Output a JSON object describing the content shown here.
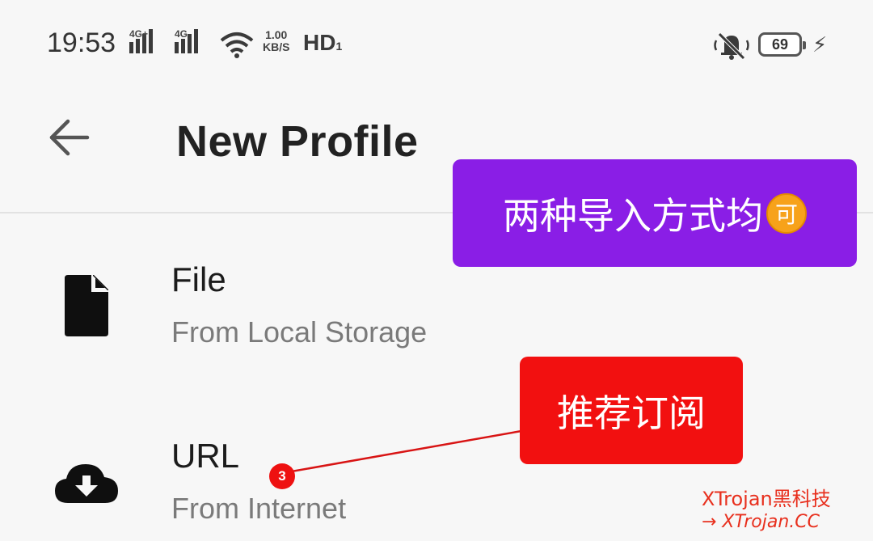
{
  "status_bar": {
    "time": "19:53",
    "net1": "4G+",
    "net2": "4G",
    "speed_value": "1.00",
    "speed_unit": "KB/S",
    "hd": "HD",
    "hd_sub": "1",
    "battery": "69",
    "icons": [
      "signal-icon",
      "wifi-icon",
      "mute-icon",
      "battery-icon",
      "charging-icon"
    ]
  },
  "app_bar": {
    "title": "New Profile",
    "back_icon": "arrow-back-icon"
  },
  "items": [
    {
      "title": "File",
      "subtitle": "From Local Storage",
      "icon": "file-icon"
    },
    {
      "title": "URL",
      "subtitle": "From Internet",
      "icon": "cloud-download-icon"
    }
  ],
  "annotations": {
    "purple_callout": "两种导入方式均",
    "purple_emoji": "可",
    "red_callout": "推荐订阅",
    "marker": "3",
    "colors": {
      "purple": "#8a1ee6",
      "red": "#f21010"
    }
  },
  "watermark": {
    "line1": "XTrojan黑科技",
    "line2": "→ XTrojan.CC"
  }
}
